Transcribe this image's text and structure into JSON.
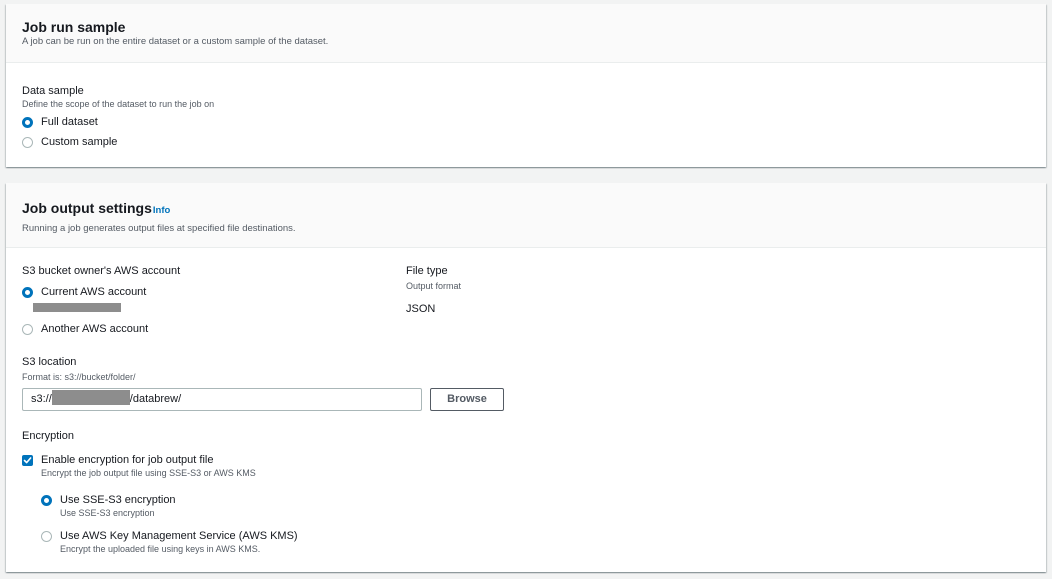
{
  "job_run_sample": {
    "title": "Job run sample",
    "description": "A job can be run on the entire dataset or a custom sample of the dataset.",
    "data_sample": {
      "label": "Data sample",
      "description": "Define the scope of the dataset to run the job on",
      "options": [
        {
          "label": "Full dataset",
          "selected": true
        },
        {
          "label": "Custom sample",
          "selected": false
        }
      ]
    }
  },
  "job_output_settings": {
    "title": "Job output settings",
    "info_link": "Info",
    "description": "Running a job generates output files at specified file destinations.",
    "s3_owner": {
      "label": "S3 bucket owner's AWS account",
      "options": [
        {
          "label": "Current AWS account",
          "selected": true
        },
        {
          "label": "Another AWS account",
          "selected": false
        }
      ]
    },
    "file_type": {
      "label": "File type",
      "sublabel": "Output format",
      "value": "JSON"
    },
    "s3_location": {
      "label": "S3 location",
      "hint": "Format is: s3://bucket/folder/",
      "value_prefix": "s3://",
      "value_suffix": "/databrew/",
      "browse_label": "Browse"
    },
    "encryption": {
      "label": "Encryption",
      "checkbox_label": "Enable encryption for job output file",
      "checkbox_desc": "Encrypt the job output file using SSE-S3 or AWS KMS",
      "checked": true,
      "options": [
        {
          "label": "Use SSE-S3 encryption",
          "desc": "Use SSE-S3 encryption",
          "selected": true
        },
        {
          "label": "Use AWS Key Management Service (AWS KMS)",
          "desc": "Encrypt the uploaded file using keys in AWS KMS.",
          "selected": false
        }
      ]
    }
  },
  "colors": {
    "accent": "#0073bb",
    "page_bg": "#f2f3f3",
    "redaction": "#8d8d8d"
  }
}
